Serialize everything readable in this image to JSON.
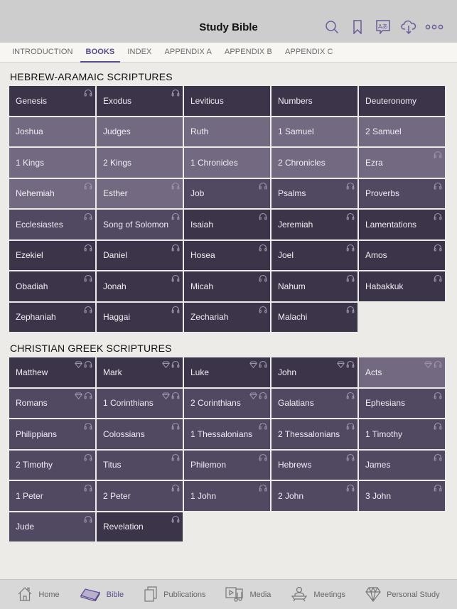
{
  "header": {
    "title": "Study Bible",
    "icons": [
      "search-icon",
      "bookmark-icon",
      "language-icon",
      "download-cloud-icon",
      "more-icon"
    ]
  },
  "tabs": [
    {
      "label": "INTRODUCTION",
      "active": false
    },
    {
      "label": "BOOKS",
      "active": true
    },
    {
      "label": "INDEX",
      "active": false
    },
    {
      "label": "APPENDIX A",
      "active": false
    },
    {
      "label": "APPENDIX B",
      "active": false
    },
    {
      "label": "APPENDIX C",
      "active": false
    }
  ],
  "colors": {
    "accent": "#5b4a8a",
    "tile_dark": "#3c3448",
    "tile_medium": "#514862",
    "tile_light": "#736a82",
    "background": "#ecebe8"
  },
  "sections": [
    {
      "title": "HEBREW-ARAMAIC SCRIPTURES",
      "books": [
        {
          "name": "Genesis",
          "shade": "dark",
          "audio": true,
          "study": false
        },
        {
          "name": "Exodus",
          "shade": "dark",
          "audio": true,
          "study": false
        },
        {
          "name": "Leviticus",
          "shade": "dark",
          "audio": false,
          "study": false
        },
        {
          "name": "Numbers",
          "shade": "dark",
          "audio": false,
          "study": false
        },
        {
          "name": "Deuteronomy",
          "shade": "dark",
          "audio": false,
          "study": false
        },
        {
          "name": "Joshua",
          "shade": "light",
          "audio": false,
          "study": false
        },
        {
          "name": "Judges",
          "shade": "light",
          "audio": false,
          "study": false
        },
        {
          "name": "Ruth",
          "shade": "light",
          "audio": false,
          "study": false
        },
        {
          "name": "1 Samuel",
          "shade": "light",
          "audio": false,
          "study": false
        },
        {
          "name": "2 Samuel",
          "shade": "light",
          "audio": false,
          "study": false
        },
        {
          "name": "1 Kings",
          "shade": "light",
          "audio": false,
          "study": false
        },
        {
          "name": "2 Kings",
          "shade": "light",
          "audio": false,
          "study": false
        },
        {
          "name": "1 Chronicles",
          "shade": "light",
          "audio": false,
          "study": false
        },
        {
          "name": "2 Chronicles",
          "shade": "light",
          "audio": false,
          "study": false
        },
        {
          "name": "Ezra",
          "shade": "light",
          "audio": true,
          "study": false
        },
        {
          "name": "Nehemiah",
          "shade": "light",
          "audio": true,
          "study": false
        },
        {
          "name": "Esther",
          "shade": "light",
          "audio": true,
          "study": false
        },
        {
          "name": "Job",
          "shade": "medium",
          "audio": true,
          "study": false
        },
        {
          "name": "Psalms",
          "shade": "medium",
          "audio": true,
          "study": false
        },
        {
          "name": "Proverbs",
          "shade": "medium",
          "audio": true,
          "study": false
        },
        {
          "name": "Ecclesiastes",
          "shade": "medium",
          "audio": true,
          "study": false
        },
        {
          "name": "Song of Solomon",
          "shade": "medium",
          "audio": true,
          "study": false
        },
        {
          "name": "Isaiah",
          "shade": "dark",
          "audio": true,
          "study": false
        },
        {
          "name": "Jeremiah",
          "shade": "dark",
          "audio": true,
          "study": false
        },
        {
          "name": "Lamentations",
          "shade": "dark",
          "audio": true,
          "study": false
        },
        {
          "name": "Ezekiel",
          "shade": "dark",
          "audio": true,
          "study": false
        },
        {
          "name": "Daniel",
          "shade": "dark",
          "audio": true,
          "study": false
        },
        {
          "name": "Hosea",
          "shade": "dark",
          "audio": true,
          "study": false
        },
        {
          "name": "Joel",
          "shade": "dark",
          "audio": true,
          "study": false
        },
        {
          "name": "Amos",
          "shade": "dark",
          "audio": true,
          "study": false
        },
        {
          "name": "Obadiah",
          "shade": "dark",
          "audio": true,
          "study": false
        },
        {
          "name": "Jonah",
          "shade": "dark",
          "audio": true,
          "study": false
        },
        {
          "name": "Micah",
          "shade": "dark",
          "audio": true,
          "study": false
        },
        {
          "name": "Nahum",
          "shade": "dark",
          "audio": true,
          "study": false
        },
        {
          "name": "Habakkuk",
          "shade": "dark",
          "audio": true,
          "study": false
        },
        {
          "name": "Zephaniah",
          "shade": "dark",
          "audio": true,
          "study": false
        },
        {
          "name": "Haggai",
          "shade": "dark",
          "audio": true,
          "study": false
        },
        {
          "name": "Zechariah",
          "shade": "dark",
          "audio": true,
          "study": false
        },
        {
          "name": "Malachi",
          "shade": "dark",
          "audio": true,
          "study": false
        }
      ]
    },
    {
      "title": "CHRISTIAN GREEK SCRIPTURES",
      "books": [
        {
          "name": "Matthew",
          "shade": "dark",
          "audio": true,
          "study": true
        },
        {
          "name": "Mark",
          "shade": "dark",
          "audio": true,
          "study": true
        },
        {
          "name": "Luke",
          "shade": "dark",
          "audio": true,
          "study": true
        },
        {
          "name": "John",
          "shade": "dark",
          "audio": true,
          "study": true
        },
        {
          "name": "Acts",
          "shade": "light",
          "audio": true,
          "study": true
        },
        {
          "name": "Romans",
          "shade": "medium",
          "audio": true,
          "study": true
        },
        {
          "name": "1 Corinthians",
          "shade": "medium",
          "audio": true,
          "study": true
        },
        {
          "name": "2 Corinthians",
          "shade": "medium",
          "audio": true,
          "study": true
        },
        {
          "name": "Galatians",
          "shade": "medium",
          "audio": true,
          "study": false
        },
        {
          "name": "Ephesians",
          "shade": "medium",
          "audio": true,
          "study": false
        },
        {
          "name": "Philippians",
          "shade": "medium",
          "audio": true,
          "study": false
        },
        {
          "name": "Colossians",
          "shade": "medium",
          "audio": true,
          "study": false
        },
        {
          "name": "1 Thessalonians",
          "shade": "medium",
          "audio": true,
          "study": false
        },
        {
          "name": "2 Thessalonians",
          "shade": "medium",
          "audio": true,
          "study": false
        },
        {
          "name": "1 Timothy",
          "shade": "medium",
          "audio": true,
          "study": false
        },
        {
          "name": "2 Timothy",
          "shade": "medium",
          "audio": true,
          "study": false
        },
        {
          "name": "Titus",
          "shade": "medium",
          "audio": true,
          "study": false
        },
        {
          "name": "Philemon",
          "shade": "medium",
          "audio": true,
          "study": false
        },
        {
          "name": "Hebrews",
          "shade": "medium",
          "audio": true,
          "study": false
        },
        {
          "name": "James",
          "shade": "medium",
          "audio": true,
          "study": false
        },
        {
          "name": "1 Peter",
          "shade": "medium",
          "audio": true,
          "study": false
        },
        {
          "name": "2 Peter",
          "shade": "medium",
          "audio": true,
          "study": false
        },
        {
          "name": "1 John",
          "shade": "medium",
          "audio": true,
          "study": false
        },
        {
          "name": "2 John",
          "shade": "medium",
          "audio": true,
          "study": false
        },
        {
          "name": "3 John",
          "shade": "medium",
          "audio": true,
          "study": false
        },
        {
          "name": "Jude",
          "shade": "medium",
          "audio": true,
          "study": false
        },
        {
          "name": "Revelation",
          "shade": "dark",
          "audio": true,
          "study": false
        }
      ]
    }
  ],
  "bottom_nav": [
    {
      "label": "Home",
      "icon": "home-icon",
      "active": false
    },
    {
      "label": "Bible",
      "icon": "bible-icon",
      "active": true
    },
    {
      "label": "Publications",
      "icon": "publications-icon",
      "active": false
    },
    {
      "label": "Media",
      "icon": "media-icon",
      "active": false
    },
    {
      "label": "Meetings",
      "icon": "meetings-icon",
      "active": false
    },
    {
      "label": "Personal Study",
      "icon": "personal-study-icon",
      "active": false
    }
  ]
}
